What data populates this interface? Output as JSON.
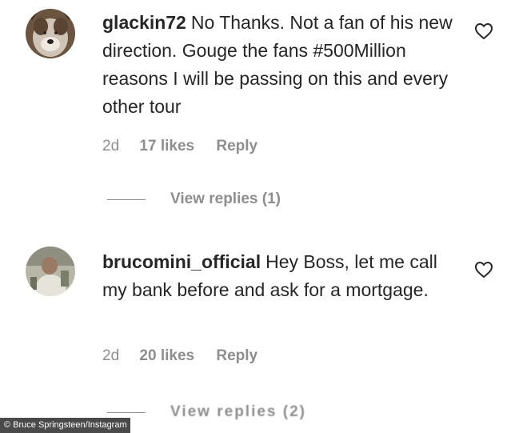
{
  "comments": [
    {
      "username": "glackin72",
      "text": "No Thanks. Not a fan of his new direction. Gouge the fans #500Million reasons I will be passing on this and every other tour",
      "time": "2d",
      "likes": "17 likes",
      "reply_label": "Reply",
      "view_replies": "View replies (1)",
      "avatar_icon": "dog-avatar-icon",
      "like_icon": "heart-outline-icon"
    },
    {
      "username": "brucomini_official",
      "text": "Hey Boss, let me call my bank before and ask for a mortgage.",
      "time": "2d",
      "likes": "20 likes",
      "reply_label": "Reply",
      "view_replies": "View replies (2)",
      "avatar_icon": "person-avatar-icon",
      "like_icon": "heart-outline-icon"
    }
  ],
  "credit": "© Bruce Springsteen/Instagram",
  "colors": {
    "text": "#262626",
    "secondary": "#8e8e8e",
    "credit_bg": "#4a4a4a"
  }
}
